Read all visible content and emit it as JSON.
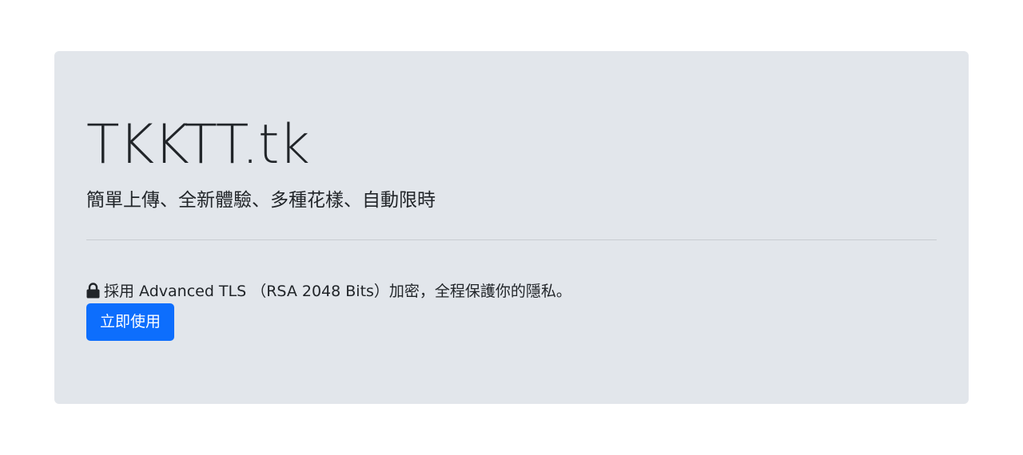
{
  "hero": {
    "title": "TKKTT.tk",
    "tagline": "簡單上傳、全新體驗、多種花樣、自動限時",
    "security_text": "採用 Advanced TLS （RSA 2048 Bits）加密，全程保護你的隱私。",
    "security_icon": "lock-icon",
    "cta_label": "立即使用"
  },
  "colors": {
    "page_background": "#ffffff",
    "panel_background": "#e2e6eb",
    "text": "#212529",
    "divider": "#c8ccd1",
    "button_background": "#0d6efd",
    "button_text": "#ffffff"
  }
}
